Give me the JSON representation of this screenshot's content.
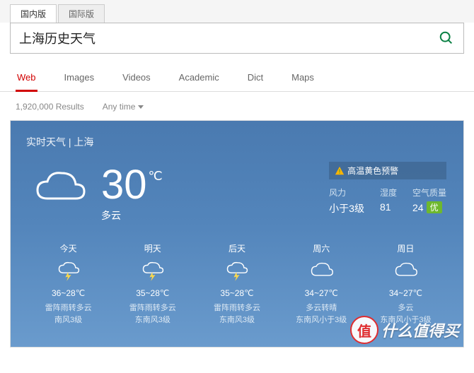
{
  "version_tabs": {
    "domestic": "国内版",
    "intl": "国际版"
  },
  "search": {
    "query": "上海历史天气"
  },
  "categories": [
    "Web",
    "Images",
    "Videos",
    "Academic",
    "Dict",
    "Maps"
  ],
  "results_count": "1,920,000 Results",
  "time_filter": "Any time",
  "weather": {
    "title_prefix": "实时天气",
    "sep": " | ",
    "city": "上海",
    "current": {
      "temp": "30",
      "unit": "℃",
      "desc": "多云"
    },
    "warning": "高温黄色预警",
    "stats": {
      "wind_label": "风力",
      "wind_val": "小于3级",
      "humidity_label": "湿度",
      "humidity_val": "81",
      "aqi_label": "空气质量",
      "aqi_val": "24",
      "aqi_grade": "优"
    },
    "forecast": [
      {
        "name": "今天",
        "icon": "thunder",
        "temp": "36~28℃",
        "desc": "雷阵雨转多云",
        "wind": "南风3级"
      },
      {
        "name": "明天",
        "icon": "thunder",
        "temp": "35~28℃",
        "desc": "雷阵雨转多云",
        "wind": "东南风3级"
      },
      {
        "name": "后天",
        "icon": "thunder",
        "temp": "35~28℃",
        "desc": "雷阵雨转多云",
        "wind": "东南风3级"
      },
      {
        "name": "周六",
        "icon": "cloud",
        "temp": "34~27℃",
        "desc": "多云转晴",
        "wind": "东南风小于3级"
      },
      {
        "name": "周日",
        "icon": "cloud",
        "temp": "34~27℃",
        "desc": "多云",
        "wind": "东南风小于3级"
      }
    ]
  },
  "watermark": "什么值得买"
}
